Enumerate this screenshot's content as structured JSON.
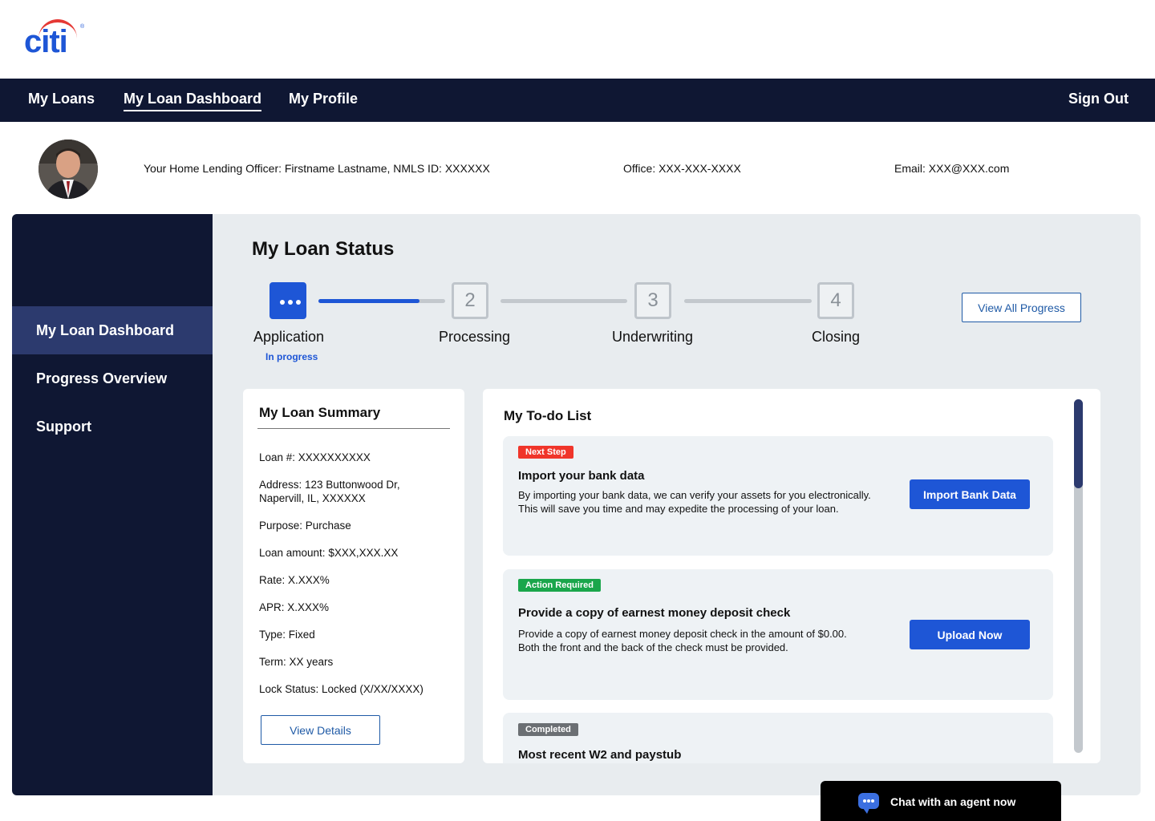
{
  "brand": {
    "logo_text": "citi",
    "logo_reg": "®",
    "primary_color": "#1e56d6",
    "accent_color": "#e53935",
    "nav_color": "#0f1733"
  },
  "nav": {
    "items": [
      {
        "label": "My Loans"
      },
      {
        "label": "My Loan Dashboard",
        "active": true
      },
      {
        "label": "My Profile"
      }
    ],
    "sign_out": "Sign Out"
  },
  "officer": {
    "lending_officer": "Your Home Lending Officer: Firstname Lastname, NMLS ID: XXXXXX",
    "office": "Office: XXX-XXX-XXXX",
    "email": "Email: XXX@XXX.com"
  },
  "sidebar": {
    "items": [
      {
        "label": "My Loan Dashboard",
        "active": true
      },
      {
        "label": "Progress Overview"
      },
      {
        "label": "Support"
      }
    ]
  },
  "loan_status": {
    "title": "My Loan Status",
    "steps": [
      {
        "number": "",
        "label": "Application",
        "sub": "In progress",
        "state": "active"
      },
      {
        "number": "2",
        "label": "Processing"
      },
      {
        "number": "3",
        "label": "Underwriting"
      },
      {
        "number": "4",
        "label": "Closing"
      }
    ],
    "application_progress_fraction": 0.8,
    "view_all_label": "View All Progress"
  },
  "summary": {
    "title": "My Loan Summary",
    "lines": [
      "Loan #: XXXXXXXXXX",
      "Address: 123 Buttonwood Dr, Napervill, IL, XXXXXX",
      "Purpose: Purchase",
      "Loan amount: $XXX,XXX.XX",
      "Rate: X.XXX%",
      "APR: X.XXX%",
      "Type: Fixed",
      "Term: XX years",
      "Lock Status: Locked (X/XX/XXXX)"
    ],
    "details_label": "View Details"
  },
  "todo": {
    "title": "My To-do List",
    "tasks": [
      {
        "badge": "Next Step",
        "badge_color": "#f0352a",
        "title": "Import your bank data",
        "description": "By importing your bank data, we can verify your assets for you electronically. This will save you time and may expedite the processing of your loan.",
        "button": "Import Bank Data"
      },
      {
        "badge": "Action Required",
        "badge_color": "#1aa64b",
        "title": "Provide a copy of earnest money deposit check",
        "description": "Provide a copy of earnest money deposit check in the amount of $0.00. Both the front and the back of the check must be provided.",
        "button": "Upload Now"
      },
      {
        "badge": "Completed",
        "badge_color": "#6b6f73",
        "title": "Most recent W2 and paystub"
      }
    ]
  },
  "chat": {
    "label": "Chat with an agent now"
  }
}
